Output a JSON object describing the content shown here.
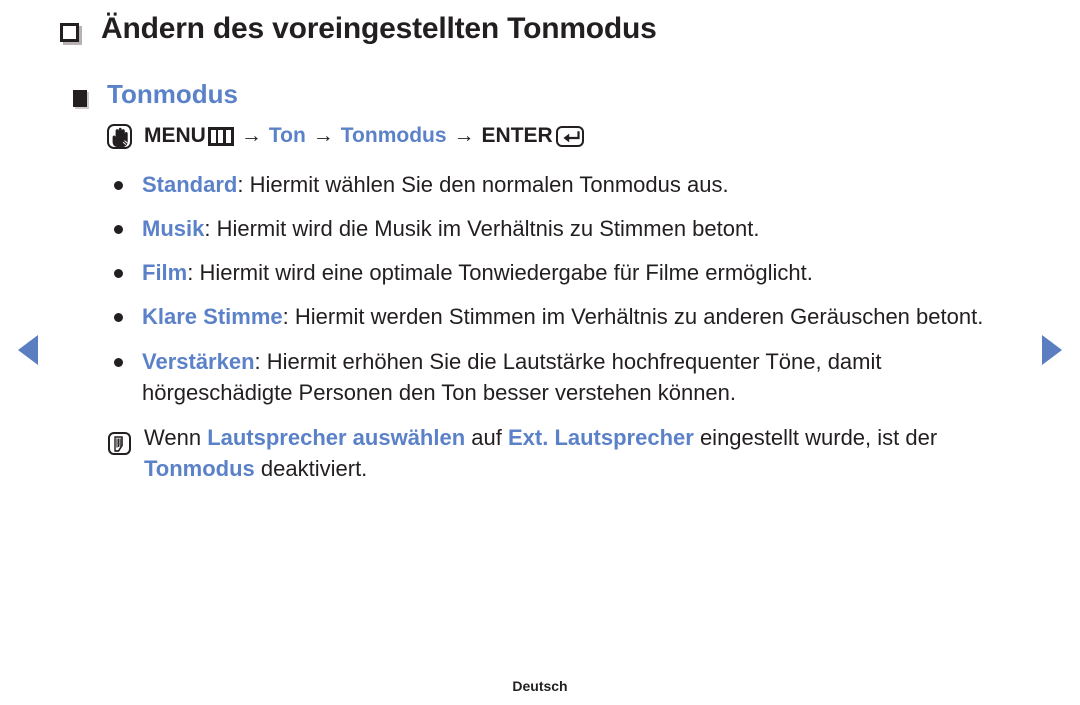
{
  "page": {
    "heading": "Ändern des voreingestellten Tonmodus",
    "subheading": "Tonmodus",
    "footer": "Deutsch",
    "accent_color": "#5b82c8",
    "text_color": "#231f20",
    "background_color": "#ffffff"
  },
  "nav": {
    "prev_label": "prev-page-arrow",
    "next_label": "next-page-arrow",
    "arrow_color": "#5a7ec0"
  },
  "menu_path": {
    "touch_icon": "hand-touch-icon",
    "menu_label": "MENU",
    "menu_icon": "menu-grid-icon",
    "arrow": "→",
    "step1": "Ton",
    "step2": "Tonmodus",
    "enter_label": "ENTER",
    "enter_icon": "enter-key-icon"
  },
  "bullets": [
    {
      "term": "Standard",
      "separator": ": ",
      "description": "Hiermit wählen Sie den normalen Tonmodus aus."
    },
    {
      "term": "Musik",
      "separator": ": ",
      "description": "Hiermit wird die Musik im Verhältnis zu Stimmen betont."
    },
    {
      "term": "Film",
      "separator": ": ",
      "description": "Hiermit wird eine optimale Tonwiedergabe für Filme ermöglicht."
    },
    {
      "term": "Klare Stimme",
      "separator": ": ",
      "description": "Hiermit werden Stimmen im Verhältnis zu anderen Geräuschen betont."
    },
    {
      "term": "Verstärken",
      "separator": ": ",
      "description": "Hiermit erhöhen Sie die Lautstärke hochfrequenter Töne, damit hörgeschädigte Personen den Ton besser verstehen können."
    }
  ],
  "note": {
    "icon": "note-pencil-icon",
    "part1": "Wenn ",
    "term1": "Lautsprecher auswählen",
    "part2": " auf ",
    "term2": "Ext. Lautsprecher",
    "part3": " eingestellt wurde, ist der ",
    "term3": "Tonmodus",
    "part4": " deaktiviert."
  }
}
